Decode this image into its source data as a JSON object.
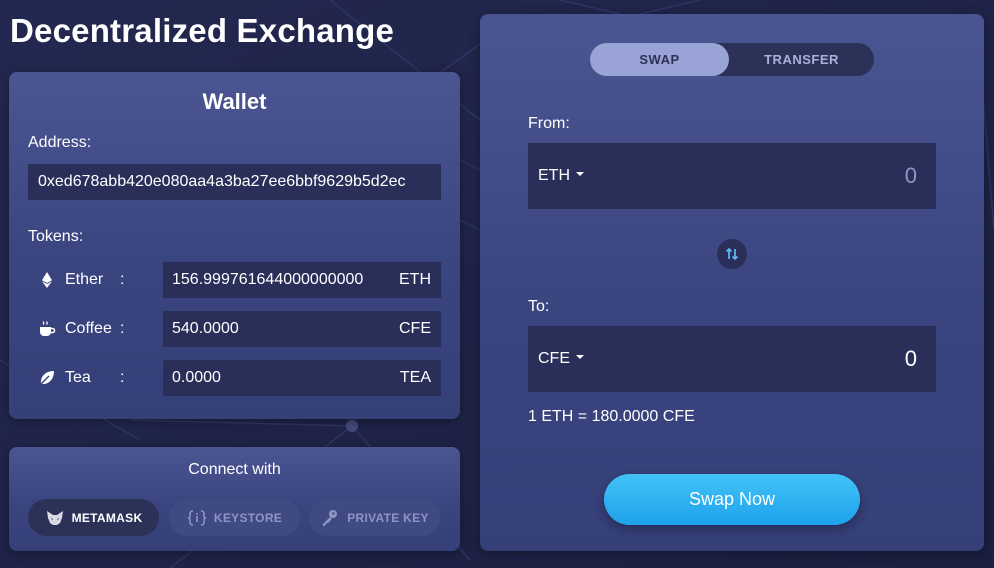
{
  "app": {
    "title": "Decentralized Exchange"
  },
  "colors": {
    "accent": "#2aa8f0",
    "panel": "#3d4884",
    "field": "#2a2f5a",
    "background": "#1e2347"
  },
  "wallet": {
    "title": "Wallet",
    "address_label": "Address:",
    "address": "0xed678abb420e080aa4a3ba27ee6bbf9629b5d2ec",
    "tokens_label": "Tokens:",
    "tokens": [
      {
        "name": "Ether",
        "colon": ":",
        "value": "156.999761644000000000",
        "symbol": "ETH",
        "icon": "ethereum-icon"
      },
      {
        "name": "Coffee",
        "colon": ":",
        "value": "540.0000",
        "symbol": "CFE",
        "icon": "coffee-cup-icon"
      },
      {
        "name": "Tea",
        "colon": ":",
        "value": "0.0000",
        "symbol": "TEA",
        "icon": "tea-leaf-icon"
      }
    ]
  },
  "connect": {
    "title": "Connect with",
    "options": [
      {
        "label": "METAMASK",
        "icon": "metamask-fox-icon",
        "active": true
      },
      {
        "label": "KEYSTORE",
        "icon": "keystore-braces-icon",
        "active": false
      },
      {
        "label": "PRIVATE KEY",
        "icon": "key-icon",
        "active": false
      }
    ]
  },
  "swap": {
    "tabs": [
      {
        "label": "SWAP",
        "active": true
      },
      {
        "label": "TRANSFER",
        "active": false
      }
    ],
    "from_label": "From:",
    "from_token": "ETH",
    "from_amount_placeholder": "0",
    "to_label": "To:",
    "to_token": "CFE",
    "to_amount": "0",
    "rate": "1 ETH = 180.0000 CFE",
    "button_label": "Swap Now"
  }
}
